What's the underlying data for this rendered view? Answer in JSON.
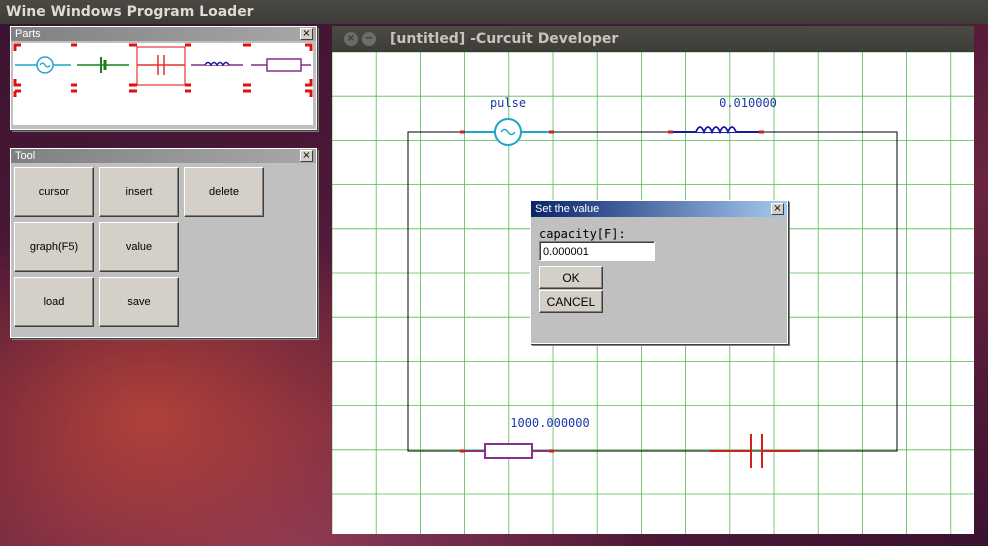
{
  "desktop": {
    "app_title": "Wine Windows Program Loader"
  },
  "parts_window": {
    "title": "Parts",
    "close": "×"
  },
  "tool_window": {
    "title": "Tool",
    "close": "×",
    "buttons": [
      "cursor",
      "insert",
      "delete",
      "graph(F5)",
      "value",
      "load",
      "save"
    ]
  },
  "main_window": {
    "title": "[untitled] -Curcuit Developer",
    "close_glyph": "×",
    "min_glyph": "−"
  },
  "circuit": {
    "source_label": "pulse",
    "inductor_label": "0.010000",
    "resistor_label": "1000.000000",
    "colors": {
      "source": "#1fa5c8",
      "inductor": "#1a1a9a",
      "resistor": "#8a2f8a",
      "capacitor": "#d42020",
      "grid": "#55bb55",
      "terminal": "#cc2222"
    }
  },
  "dialog": {
    "title": "Set the value",
    "close": "×",
    "label": "capacity[F]:",
    "value": "0.000001",
    "ok": "OK",
    "cancel": "CANCEL"
  }
}
